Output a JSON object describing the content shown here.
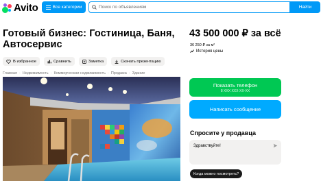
{
  "header": {
    "logo_text": "Avito",
    "categories_label": "Все категории",
    "search_placeholder": "Поиск по объявлениям",
    "find_label": "Найти"
  },
  "listing": {
    "title": "Готовый бизнес: Гостиница, Баня, Автосервис",
    "price": "43 500 000 ₽ за всё",
    "price_per_m2": "36 250 ₽ за м²",
    "price_history": "История цены"
  },
  "actions": [
    {
      "label": "В избранное",
      "icon": "heart-icon"
    },
    {
      "label": "Сравнить",
      "icon": "compare-icon"
    },
    {
      "label": "Заметка",
      "icon": "note-icon"
    },
    {
      "label": "Скачать презентацию",
      "icon": "download-icon"
    }
  ],
  "breadcrumbs": [
    "Главная",
    "Недвижимость",
    "Коммерческая недвижимость",
    "Продажа",
    "Здание"
  ],
  "contact": {
    "phone_label": "Показать телефон",
    "phone_mask": "8 XXX XXX-XX-XX",
    "message_label": "Написать сообщение",
    "ask_title": "Спросите у продавца",
    "ask_text": "Здравствуйте!",
    "quick_question": "Когда можно посмотреть?"
  },
  "colors": {
    "brand_blue": "#0099f7",
    "green": "#00c853",
    "light_blue": "#00aaff"
  }
}
